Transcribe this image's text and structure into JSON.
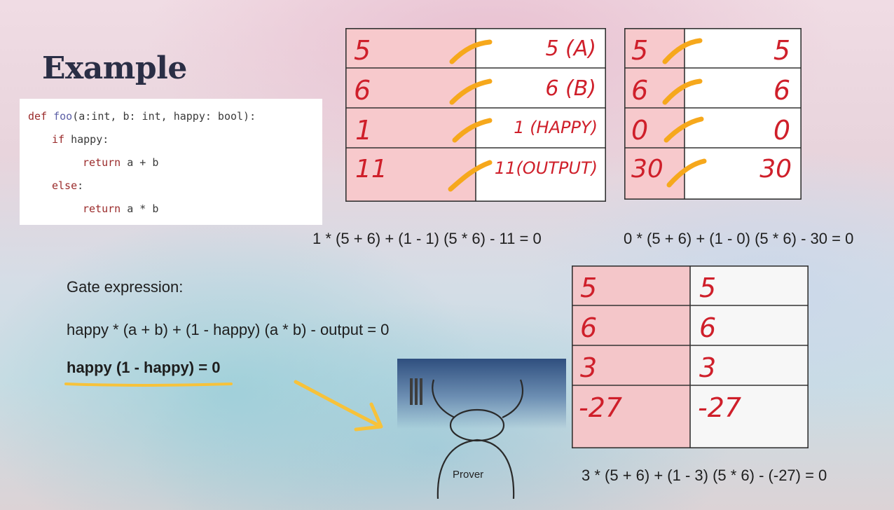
{
  "title": "Example",
  "code": {
    "line1_def": "def",
    "line1_fn": "foo",
    "line1_rest": "(a:int, b: int, happy: bool):",
    "line2_kw": "if",
    "line2_rest": " happy:",
    "line3_kw": "return",
    "line3_rest": " a + b",
    "line4_kw": "else",
    "line4_rest": ":",
    "line5_kw": "return",
    "line5_rest": " a * b"
  },
  "table1": {
    "left": [
      "5",
      "6",
      "1",
      "11"
    ],
    "right": [
      "5 (A)",
      "6 (B)",
      "1 (HAPPY)",
      "11(OUTPUT)"
    ]
  },
  "table2": {
    "left": [
      "5",
      "6",
      "0",
      "30"
    ],
    "right": [
      "5",
      "6",
      "0",
      "30"
    ]
  },
  "table3": {
    "left": [
      "5",
      "6",
      "3",
      "-27"
    ],
    "right": [
      "5",
      "6",
      "3",
      "-27"
    ]
  },
  "equations": {
    "eq1": "1 * (5 + 6) + (1 - 1) (5 * 6) - 11 = 0",
    "eq2": "0 * (5 + 6) + (1 - 0) (5 * 6) - 30 = 0",
    "eq3": "3 * (5 + 6) + (1 - 3) (5 * 6) - (-27) = 0"
  },
  "gate": {
    "heading": "Gate expression:",
    "expr1": "happy * (a + b) + (1 - happy) (a * b) - output = 0",
    "expr2": "happy (1 - happy) = 0"
  },
  "prover": {
    "label": "Prover"
  },
  "colors": {
    "highlight_pink": "#f7c9cc",
    "marker_orange": "#f6a81c",
    "ink_red": "#cf1f2a",
    "underline_yellow": "#f7c23a"
  }
}
